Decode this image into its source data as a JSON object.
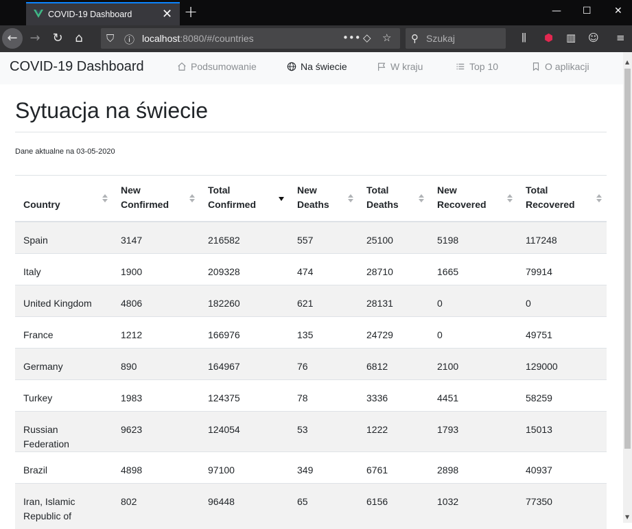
{
  "browser": {
    "tab_title": "COVID-19 Dashboard",
    "url_host": "localhost",
    "url_rest": ":8080/#/countries",
    "search_placeholder": "Szukaj",
    "accent_color": "#0a84ff"
  },
  "app": {
    "brand": "COVID-19 Dashboard",
    "nav": [
      {
        "label": "Podsumowanie",
        "icon": "home-icon",
        "active": false
      },
      {
        "label": "Na świecie",
        "icon": "globe-icon",
        "active": true
      },
      {
        "label": "W kraju",
        "icon": "flag-icon",
        "active": false
      },
      {
        "label": "Top 10",
        "icon": "list-icon",
        "active": false
      },
      {
        "label": "O aplikacji",
        "icon": "bookmark-icon",
        "active": false
      }
    ]
  },
  "page": {
    "title": "Sytuacja na świecie",
    "updated": "Dane aktualne na 03-05-2020"
  },
  "table": {
    "columns": [
      {
        "label": "Country",
        "sort": "none"
      },
      {
        "label": "New Confirmed",
        "sort": "none"
      },
      {
        "label": "Total Confirmed",
        "sort": "desc"
      },
      {
        "label": "New Deaths",
        "sort": "none"
      },
      {
        "label": "Total Deaths",
        "sort": "none"
      },
      {
        "label": "New Recovered",
        "sort": "none"
      },
      {
        "label": "Total Recovered",
        "sort": "none"
      }
    ],
    "rows": [
      [
        "Spain",
        "3147",
        "216582",
        "557",
        "25100",
        "5198",
        "117248"
      ],
      [
        "Italy",
        "1900",
        "209328",
        "474",
        "28710",
        "1665",
        "79914"
      ],
      [
        "United Kingdom",
        "4806",
        "182260",
        "621",
        "28131",
        "0",
        "0"
      ],
      [
        "France",
        "1212",
        "166976",
        "135",
        "24729",
        "0",
        "49751"
      ],
      [
        "Germany",
        "890",
        "164967",
        "76",
        "6812",
        "2100",
        "129000"
      ],
      [
        "Turkey",
        "1983",
        "124375",
        "78",
        "3336",
        "4451",
        "58259"
      ],
      [
        "Russian Federation",
        "9623",
        "124054",
        "53",
        "1222",
        "1793",
        "15013"
      ],
      [
        "Brazil",
        "4898",
        "97100",
        "349",
        "6761",
        "2898",
        "40937"
      ],
      [
        "Iran, Islamic Republic of",
        "802",
        "96448",
        "65",
        "6156",
        "1032",
        "77350"
      ]
    ]
  }
}
